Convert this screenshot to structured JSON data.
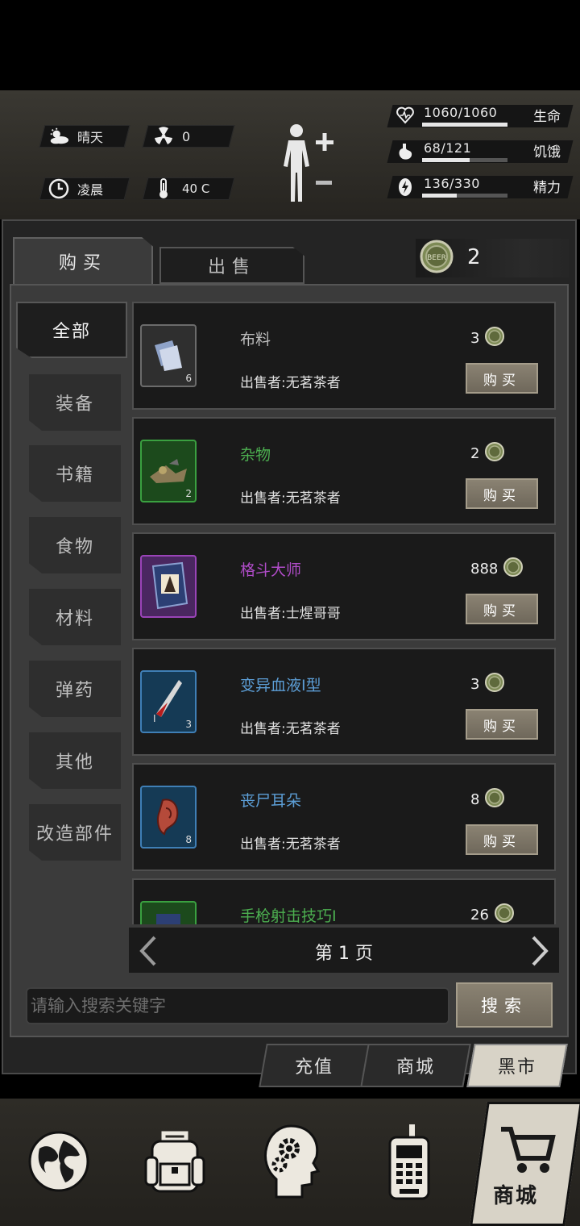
{
  "status": {
    "weather": "晴天",
    "radiation": "0",
    "time_of_day": "凌晨",
    "temperature": "40 C"
  },
  "stats": [
    {
      "label": "生命",
      "value": "1060/1060",
      "fraction": 1.0,
      "icon": "heart-icon"
    },
    {
      "label": "饥饿",
      "value": "68/121",
      "fraction": 0.56,
      "icon": "stomach-icon"
    },
    {
      "label": "精力",
      "value": "136/330",
      "fraction": 0.41,
      "icon": "energy-icon"
    }
  ],
  "tabs": {
    "buy": "购买",
    "sell": "出售"
  },
  "coins": "2",
  "categories": [
    "全部",
    "装备",
    "书籍",
    "食物",
    "材料",
    "弹药",
    "其他",
    "改造部件"
  ],
  "buy_label": "购买",
  "items": [
    {
      "name": "布料",
      "seller": "出售者:无茗茶者",
      "price": "3",
      "qty": "6",
      "name_color": "#bdbdbd",
      "frame_color": "#6b6b6b",
      "thumb_bg": "#2f2f2f"
    },
    {
      "name": "杂物",
      "seller": "出售者:无茗茶者",
      "price": "2",
      "qty": "2",
      "name_color": "#4caf50",
      "frame_color": "#3aa040",
      "thumb_bg": "#1c4a1c"
    },
    {
      "name": "格斗大师",
      "seller": "出售者:士煋哥哥",
      "price": "888",
      "qty": "",
      "name_color": "#b04cc8",
      "frame_color": "#9a44b8",
      "thumb_bg": "#4a2760"
    },
    {
      "name": "变异血液Ⅰ型",
      "seller": "出售者:无茗茶者",
      "price": "3",
      "qty": "3",
      "name_color": "#5c9ed6",
      "frame_color": "#3f7fb6",
      "thumb_bg": "#153a55"
    },
    {
      "name": "丧尸耳朵",
      "seller": "出售者:无茗茶者",
      "price": "8",
      "qty": "8",
      "name_color": "#5c9ed6",
      "frame_color": "#3f7fb6",
      "thumb_bg": "#153a55"
    },
    {
      "name": "手枪射击技巧Ⅰ",
      "seller": "",
      "price": "26",
      "qty": "",
      "name_color": "#4caf50",
      "frame_color": "#3aa040",
      "thumb_bg": "#1c4a1c"
    }
  ],
  "pager": "第 1 页",
  "search": {
    "placeholder": "请输入搜索关键字",
    "button": "搜索"
  },
  "shop_tabs": {
    "recharge": "充值",
    "store": "商城",
    "black_market": "黑市"
  },
  "nav": {
    "shop_label": "商城"
  }
}
